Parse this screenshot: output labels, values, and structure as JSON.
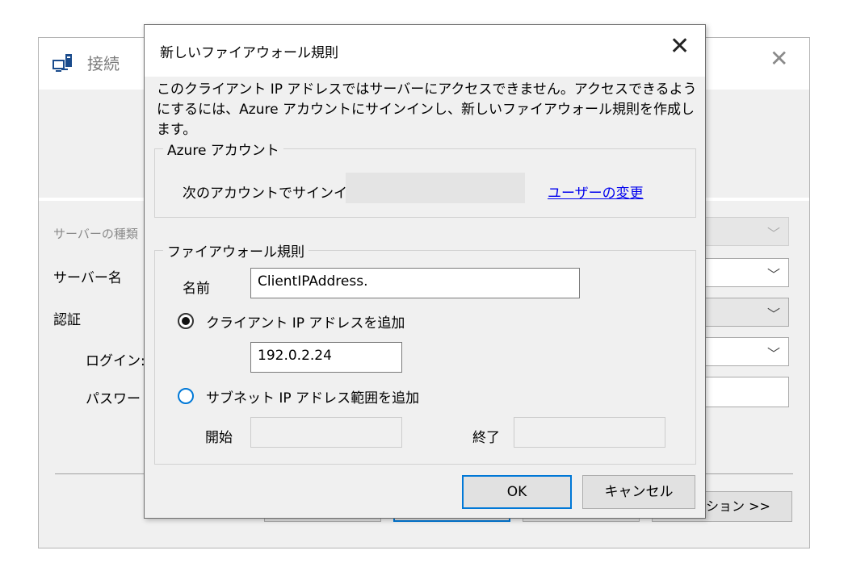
{
  "background_dialog": {
    "title": "接続",
    "server_type_label": "サーバーの種類",
    "server_name_label": "サーバー名",
    "auth_label": "認証",
    "login_label": "ログイン:",
    "password_label": "パスワード",
    "options_button": "ション >>"
  },
  "dialog": {
    "title": "新しいファイアウォール規則",
    "description": "このクライアント IP アドレスではサーバーにアクセスできません。アクセスできるようにするには、Azure アカウントにサインインし、新しいファイアウォール規則を作成します。",
    "azure_group": {
      "label": "Azure アカウント",
      "signed_in_text": "次のアカウントでサインイン",
      "change_user_link": "ユーザーの変更"
    },
    "rule_group": {
      "label": "ファイアウォール規則",
      "name_label": "名前",
      "name_value": "ClientIPAddress.",
      "client_ip_radio": "クライアント IP アドレスを追加",
      "client_ip_value": "192.0.2.24",
      "subnet_radio": "サブネット IP アドレス範囲を追加",
      "start_label": "開始",
      "end_label": "終了"
    },
    "ok_button": "OK",
    "cancel_button": "キャンセル"
  },
  "colors": {
    "accent": "#0078d7",
    "link": "#0000ee",
    "dialog_bg": "#f0f0f0"
  }
}
